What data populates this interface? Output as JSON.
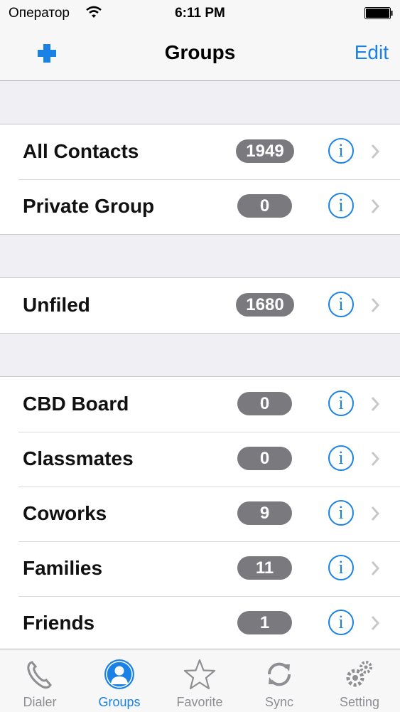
{
  "status_bar": {
    "carrier": "Оператор",
    "time": "6:11 PM"
  },
  "nav": {
    "title": "Groups",
    "edit_label": "Edit",
    "add_icon": "plus-icon"
  },
  "sections": [
    {
      "rows": [
        {
          "name": "All Contacts",
          "count": "1949"
        },
        {
          "name": "Private Group",
          "count": "0"
        }
      ]
    },
    {
      "rows": [
        {
          "name": "Unfiled",
          "count": "1680"
        }
      ]
    },
    {
      "rows": [
        {
          "name": "CBD Board",
          "count": "0"
        },
        {
          "name": "Classmates",
          "count": "0"
        },
        {
          "name": "Coworks",
          "count": "9"
        },
        {
          "name": "Families",
          "count": "11"
        },
        {
          "name": "Friends",
          "count": "1"
        }
      ]
    }
  ],
  "tabs": [
    {
      "label": "Dialer",
      "icon": "phone-icon"
    },
    {
      "label": "Groups",
      "icon": "person-circle-icon",
      "active": true
    },
    {
      "label": "Favorite",
      "icon": "star-icon"
    },
    {
      "label": "Sync",
      "icon": "sync-icon"
    },
    {
      "label": "Setting",
      "icon": "gears-icon"
    }
  ],
  "colors": {
    "accent": "#1a82e6",
    "badge": "#7a7a7e",
    "background": "#efeff4"
  }
}
